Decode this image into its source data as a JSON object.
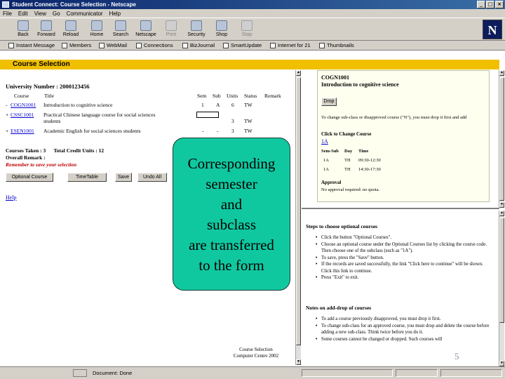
{
  "window": {
    "title": "Student Connect: Course Selection - Netscape"
  },
  "menu": [
    "File",
    "Edit",
    "View",
    "Go",
    "Communicator",
    "Help"
  ],
  "toolbar": [
    {
      "label": "Back",
      "icon": "back-icon",
      "enabled": true
    },
    {
      "label": "Forward",
      "icon": "forward-icon",
      "enabled": true
    },
    {
      "label": "Reload",
      "icon": "reload-icon",
      "enabled": true
    },
    {
      "label": "Home",
      "icon": "home-icon",
      "enabled": true
    },
    {
      "label": "Search",
      "icon": "search-icon",
      "enabled": true
    },
    {
      "label": "Netscape",
      "icon": "netscape-icon",
      "enabled": true
    },
    {
      "label": "Print",
      "icon": "print-icon",
      "enabled": false
    },
    {
      "label": "Security",
      "icon": "security-icon",
      "enabled": true
    },
    {
      "label": "Shop",
      "icon": "shop-icon",
      "enabled": true
    },
    {
      "label": "Stop",
      "icon": "stop-icon",
      "enabled": false
    }
  ],
  "personal_toolbar": [
    "Instant Message",
    "Members",
    "WebMail",
    "Connections",
    "BizJournal",
    "SmartUpdate",
    "Internet for 21",
    "Thumbnails"
  ],
  "page": {
    "heading": "Course Selection",
    "university_number": "University Number : 2000123456",
    "columns": [
      "Course",
      "Title",
      "Sem",
      "Sub",
      "Units",
      "Status",
      "Remark"
    ],
    "courses": [
      {
        "marker": "-",
        "code": "COGN1001",
        "title": "Introduction to cognitive science",
        "sem": "1",
        "sub": "A",
        "units": "6",
        "status": "TW",
        "remark": ""
      },
      {
        "marker": "+",
        "code": "CSSC1001",
        "title": "Practical Chinese language course for social sciences",
        "title2": "students",
        "sem": "",
        "sub": "",
        "units": "",
        "status": "",
        "remark": ""
      },
      {
        "marker": "+",
        "code": "ESEN1001",
        "title": "Academic English for social sciences students",
        "sem": "-",
        "sub": "-",
        "units": "3",
        "status": "TW",
        "remark": ""
      }
    ],
    "cssc_units": "3",
    "cssc_status": "TW",
    "courses_taken": "Courses Taken : 3",
    "total_credit": "Total Credit Units : 12",
    "overall_remark": "Overall Remark :",
    "remember": "Remember to save your selection",
    "buttons": [
      "Optional Course",
      "TimeTable",
      "Save",
      "Undo All"
    ],
    "help": "Help",
    "footer_line1": "Course Selection",
    "footer_line2": "Computer Centre 2002"
  },
  "callout": {
    "lines": [
      "Corresponding",
      "semester",
      "and",
      "subclass",
      "are transferred",
      "to the form"
    ]
  },
  "detail": {
    "code": "COGN1001",
    "title": "Introduction to cognitive science",
    "drop_label": "Drop",
    "note": "To change sub-class or disapproved course (\"N\"), you must drop it first and add",
    "subclass_head": "Click to Change Course",
    "subclass_link": "1A",
    "table_headers": [
      "Sem-Sub",
      "Day",
      "Time"
    ],
    "table_rows": [
      [
        "1A",
        "TH",
        "09:30-12:30"
      ],
      [
        "1A",
        "TH",
        "14:30-17:30"
      ]
    ],
    "approval_head": "Approval",
    "approval_value": "No approval required: no quota."
  },
  "help_frame": {
    "steps_title": "Steps to choose optional courses",
    "steps": [
      "Click the button \"Optional Courses\".",
      "Choose an optional course under the Optional Courses list by clicking the course code. Then choose one of the subclass (such as \"1A\").",
      "To save, press the \"Save\" button.",
      "If the records are saved successfully, the link \"Click here to continue\" will be shown. Click this link to continue.",
      "Press \"Exit\" to exit."
    ],
    "notes_title": "Notes on add-drop of courses",
    "notes": [
      "To add a course previously disapproved, you must drop it first.",
      "To change sub-class for an approved course, you must drop and delete the course before adding a new sub-class. Think twice before you do it.",
      "Some courses cannot be changed or dropped. Such courses will"
    ],
    "page_number": "5"
  },
  "status": {
    "text": "Document: Done"
  }
}
